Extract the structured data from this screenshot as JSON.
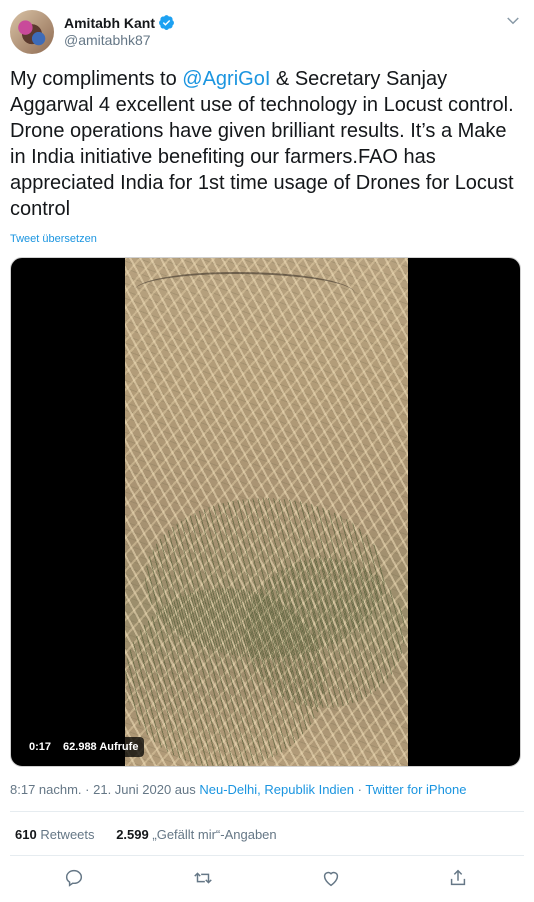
{
  "user": {
    "display_name": "Amitabh Kant",
    "handle": "@amitabhk87",
    "verified": true
  },
  "tweet": {
    "text_before_mention": "My compliments to ",
    "mention": "@AgriGoI",
    "text_after_mention": " & Secretary Sanjay Aggarwal 4 excellent use of technology in Locust control. Drone operations have given brilliant results. It’s a Make in India initiative benefiting our farmers.FAO has appreciated India for 1st time usage of Drones for Locust control",
    "translate_label": "Tweet übersetzen"
  },
  "video": {
    "duration": "0:17",
    "views": "62.988 Aufrufe"
  },
  "meta": {
    "time": "8:17 nachm.",
    "sep1": " · ",
    "date_prefix": "21. Juni 2020 aus ",
    "location": "Neu-Delhi, Republik Indien",
    "sep2": " · ",
    "source": "Twitter for iPhone"
  },
  "stats": {
    "retweets_count": "610",
    "retweets_label": "Retweets",
    "likes_count": "2.599",
    "likes_label": "„Gefällt mir“-Angaben"
  },
  "colors": {
    "accent": "#1b95e0",
    "secondary_text": "#657786",
    "primary_text": "#14171a"
  },
  "icons": [
    "verified-badge-icon",
    "chevron-down-icon",
    "reply-icon",
    "retweet-icon",
    "like-icon",
    "share-icon"
  ]
}
